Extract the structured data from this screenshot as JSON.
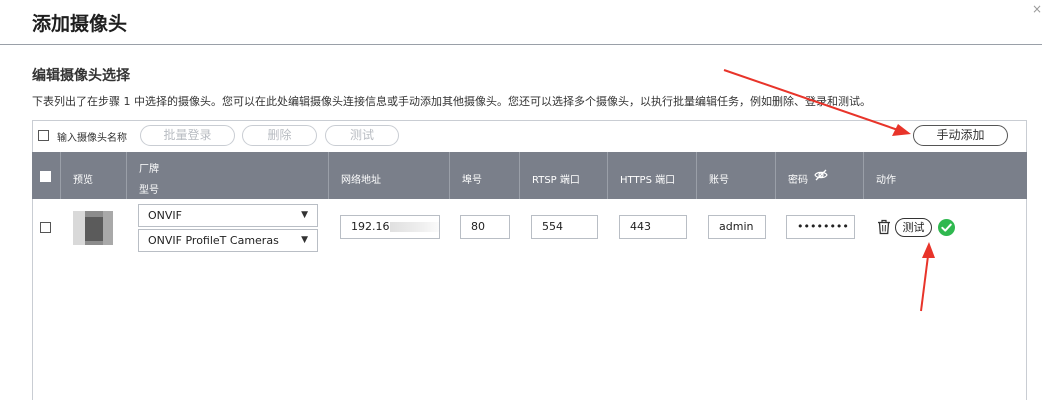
{
  "dialog": {
    "title": "添加摄像头",
    "close": "×"
  },
  "section": {
    "title": "编辑摄像头选择",
    "description": "下表列出了在步骤 1 中选择的摄像头。您可以在此处编辑摄像头连接信息或手动添加其他摄像头。您还可以选择多个摄像头，以执行批量编辑任务，例如删除、登录和测试。"
  },
  "toolbar": {
    "search_placeholder": "输入摄像头名称",
    "batch_login": "批量登录",
    "delete": "删除",
    "test": "测试",
    "manual_add": "手动添加"
  },
  "table": {
    "headers": {
      "preview": "预览",
      "vendor": "厂牌",
      "model": "型号",
      "address": "网络地址",
      "port": "埠号",
      "rtsp": "RTSP 端口",
      "https": "HTTPS 端口",
      "account": "账号",
      "password": "密码",
      "action": "动作"
    },
    "rows": [
      {
        "vendor": "ONVIF",
        "model": "ONVIF ProfileT Cameras",
        "address": "192.16",
        "port": "80",
        "rtsp_port": "554",
        "https_port": "443",
        "account": "admin",
        "password": "••••••••",
        "test_label": "测试",
        "status": "ok"
      }
    ]
  },
  "icons": {
    "eye_off": "eye-off-icon",
    "trash": "trash-icon",
    "success": "check-circle-icon",
    "dropdown": "▼"
  },
  "colors": {
    "header_bg": "#7a7f8a",
    "success": "#2fb84f",
    "annotation": "#e8342a"
  }
}
